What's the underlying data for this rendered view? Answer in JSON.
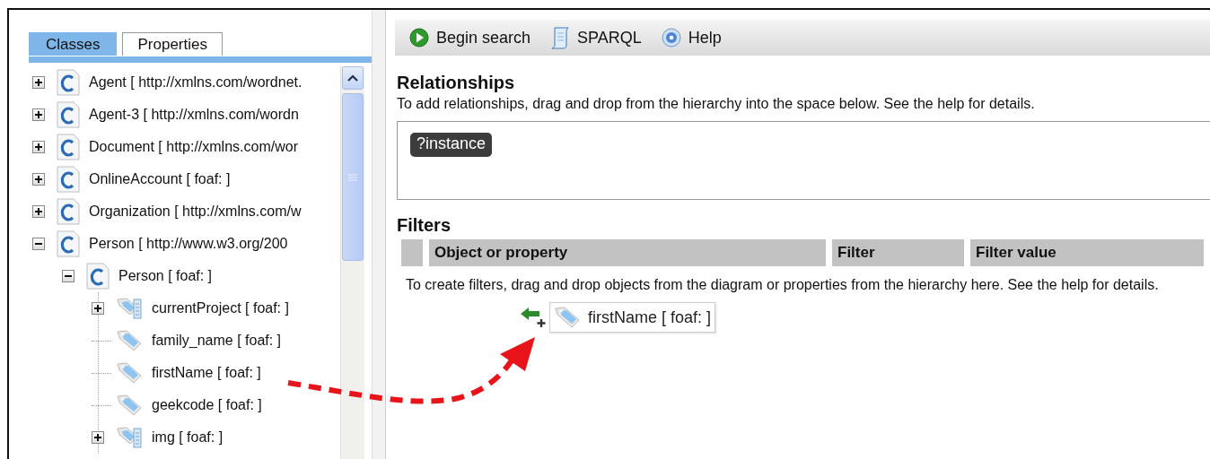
{
  "tabs": [
    {
      "label": "Classes",
      "selected": true
    },
    {
      "label": "Properties",
      "selected": false
    }
  ],
  "tree": [
    {
      "kind": "class",
      "label": "Agent [ http://xmlns.com/wordnet.",
      "expanded": false
    },
    {
      "kind": "class",
      "label": "Agent-3 [ http://xmlns.com/wordn",
      "expanded": false
    },
    {
      "kind": "class",
      "label": "Document [ http://xmlns.com/wor",
      "expanded": false
    },
    {
      "kind": "class",
      "label": "OnlineAccount [ foaf: ]",
      "expanded": false
    },
    {
      "kind": "class",
      "label": "Organization [ http://xmlns.com/w",
      "expanded": false
    },
    {
      "kind": "class",
      "label": "Person [ http://www.w3.org/200",
      "expanded": true,
      "children": [
        {
          "kind": "class",
          "label": "Person [ foaf: ]",
          "expanded": true,
          "children": [
            {
              "kind": "property-group",
              "label": "currentProject [ foaf: ]",
              "expanded": false
            },
            {
              "kind": "property",
              "label": "family_name [ foaf: ]"
            },
            {
              "kind": "property",
              "label": "firstName [ foaf: ]"
            },
            {
              "kind": "property",
              "label": "geekcode [ foaf: ]"
            },
            {
              "kind": "property-group",
              "label": "img [ foaf: ]",
              "expanded": false
            }
          ]
        }
      ]
    }
  ],
  "toolbar": [
    {
      "kind": "start",
      "label": "Begin search"
    },
    {
      "kind": "scroll",
      "label": "SPARQL"
    },
    {
      "kind": "help",
      "label": "Help"
    }
  ],
  "relationships": {
    "title": "Relationships",
    "hint": "To add relationships, drag and drop from the hierarchy into the space below. See the help for details.",
    "nodes": [
      "?instance"
    ]
  },
  "filters": {
    "title": "Filters",
    "columns": [
      "Object or property",
      "Filter",
      "Filter value"
    ],
    "hint": "To create filters, drag and drop objects from the diagram or properties from the hierarchy here. See the help for details."
  },
  "drag": {
    "kind": "property",
    "label": "firstName [ foaf: ]"
  }
}
